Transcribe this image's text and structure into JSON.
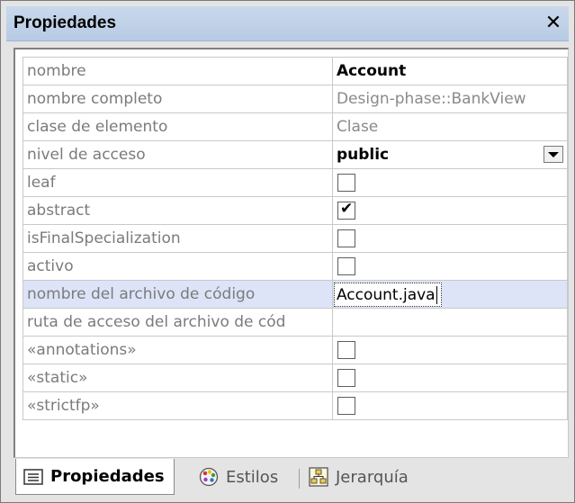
{
  "panel": {
    "title": "Propiedades",
    "close_glyph": "✕"
  },
  "properties": [
    {
      "name": "nombre",
      "type": "text",
      "value": "Account",
      "style": "bold"
    },
    {
      "name": "nombre completo",
      "type": "text",
      "value": "Design-phase::BankView",
      "style": "gray"
    },
    {
      "name": "clase de elemento",
      "type": "text",
      "value": "Clase",
      "style": "gray"
    },
    {
      "name": "nivel de acceso",
      "type": "select",
      "value": "public",
      "style": "bold"
    },
    {
      "name": "leaf",
      "type": "checkbox",
      "checked": false
    },
    {
      "name": "abstract",
      "type": "checkbox",
      "checked": true
    },
    {
      "name": "isFinalSpecialization",
      "type": "checkbox",
      "checked": false
    },
    {
      "name": "activo",
      "type": "checkbox",
      "checked": false
    },
    {
      "name": "nombre del archivo de código",
      "type": "edit",
      "value": "Account.java",
      "selected": true
    },
    {
      "name": "ruta de acceso del archivo de cód",
      "type": "text",
      "value": ""
    },
    {
      "name": "«annotations»",
      "type": "checkbox",
      "checked": false
    },
    {
      "name": "«static»",
      "type": "checkbox",
      "checked": false
    },
    {
      "name": "«strictfp»",
      "type": "checkbox",
      "checked": false
    }
  ],
  "tabs": [
    {
      "label": "Propiedades",
      "icon": "list-icon",
      "active": true
    },
    {
      "label": "Estilos",
      "icon": "palette-icon",
      "active": false
    },
    {
      "label": "Jerarquía",
      "icon": "hierarchy-icon",
      "active": false
    }
  ],
  "checkmark_glyph": "✔"
}
